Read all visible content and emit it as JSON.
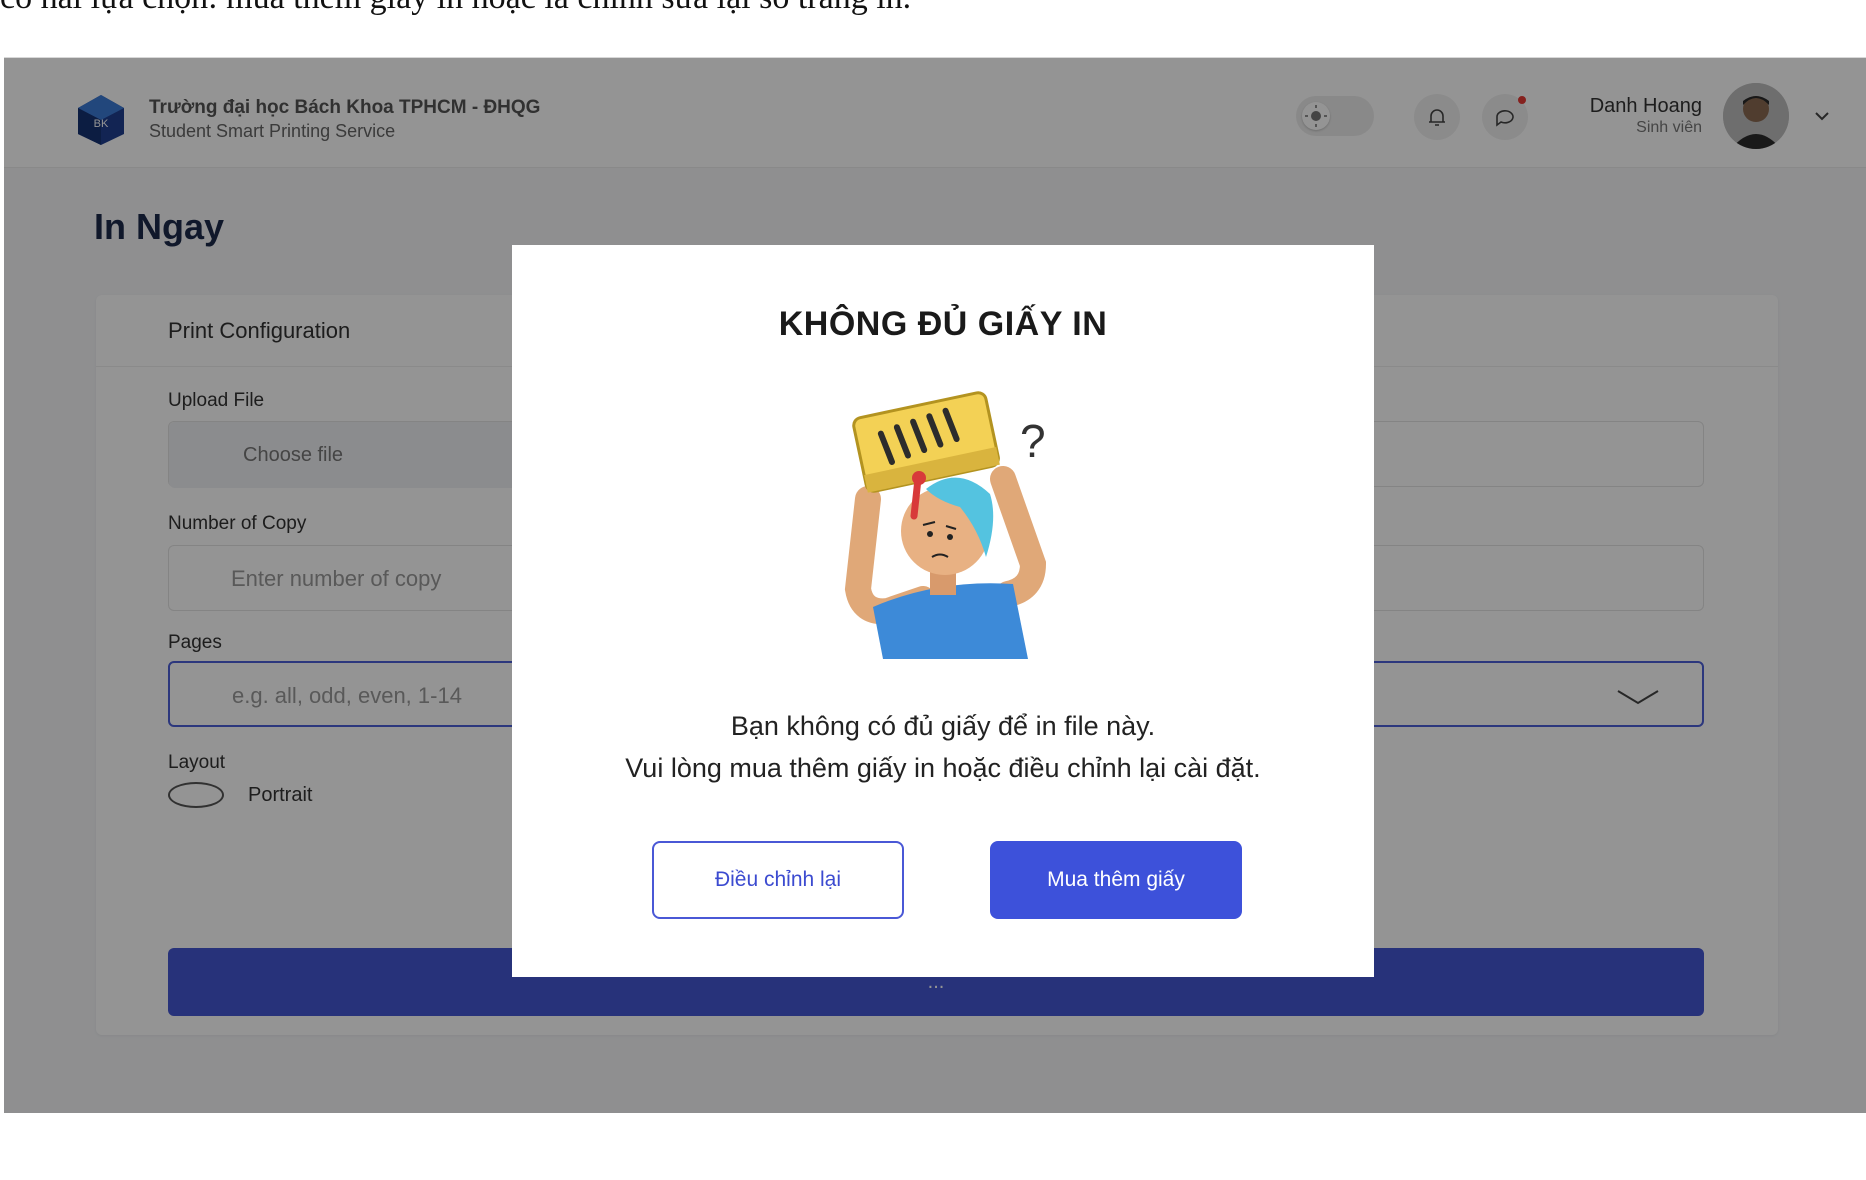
{
  "caption": "có hai lựa chọn: mua thêm giấy in hoặc là chỉnh sửa lại số trang in.",
  "header": {
    "brand_title": "Trường đại học Bách Khoa TPHCM - ĐHQG",
    "brand_subtitle": "Student Smart Printing Service",
    "logo_text": "BK",
    "user_name": "Danh Hoang",
    "user_role": "Sinh viên",
    "icons": [
      "sun-icon",
      "bell-icon",
      "chat-icon",
      "chevron-down-icon"
    ]
  },
  "page": {
    "title": "In Ngay",
    "card_title": "Print Configuration",
    "upload_label": "Upload File",
    "choose_file": "Choose file",
    "copy_label": "Number of Copy",
    "copy_placeholder": "Enter number of copy",
    "pages_label": "Pages",
    "pages_placeholder": "e.g. all, odd, even, 1-14",
    "layout_label": "Layout",
    "layout_option_portrait": "Portrait",
    "submit_label": "..."
  },
  "modal": {
    "title": "KHÔNG ĐỦ GIẤY IN",
    "message_line1": "Bạn không có đủ giấy để in file này.",
    "message_line2": "Vui lòng mua thêm giấy in hoặc điều chỉnh lại cài đặt.",
    "adjust_button": "Điều chỉnh lại",
    "buy_button": "Mua thêm giấy"
  },
  "colors": {
    "accent": "#3d51da",
    "overlay": "rgba(0,0,0,0.42)",
    "notify": "#e53935"
  }
}
